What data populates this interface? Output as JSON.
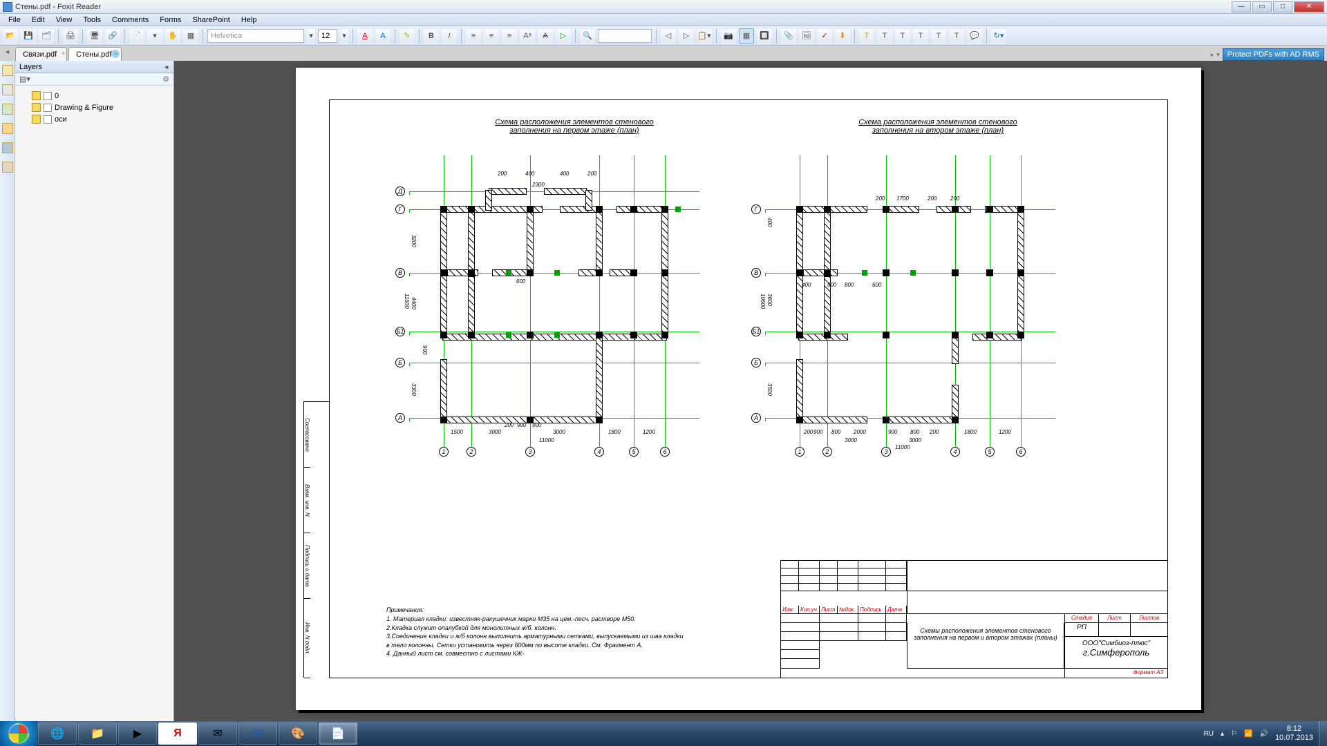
{
  "window": {
    "title": "Стены.pdf - Foxit Reader"
  },
  "menu": {
    "file": "File",
    "edit": "Edit",
    "view": "View",
    "tools": "Tools",
    "comments": "Comments",
    "forms": "Forms",
    "sharepoint": "SharePoint",
    "help": "Help"
  },
  "toolbar": {
    "font": "Helvetica",
    "size": "12"
  },
  "tabs": {
    "t1": "Связи.pdf",
    "t2": "Стены.pdf",
    "protect": "Protect PDFs with AD RMS"
  },
  "layers": {
    "title": "Layers",
    "layer0": "0",
    "layer_df": "Drawing & Figure",
    "layer_axes": "оси"
  },
  "drawing": {
    "title1a": "Схема расположения элементов стенового",
    "title1b": "заполнения на первом этаже (план)",
    "title2a": "Схема расположения элементов стенового",
    "title2b": "заполнения на втором этаже (план)",
    "axes_letters": {
      "A": "А",
      "B": "Б",
      "B1": "Б1",
      "V": "В",
      "G": "Г",
      "D": "Д"
    },
    "axes_nums": {
      "n1": "1",
      "n2": "2",
      "n3": "3",
      "n4": "4",
      "n5": "5",
      "n6": "6"
    },
    "dims": {
      "d200": "200",
      "d400": "400",
      "d600": "600",
      "d800": "800",
      "d900": "900",
      "d1200": "1200",
      "d1500": "1500",
      "d1700": "1700",
      "d1800": "1800",
      "d2000": "2000",
      "d2300": "2300",
      "d3000": "3000",
      "d3200": "3200",
      "d3300": "3300",
      "d3500": "3500",
      "d3600": "3600",
      "d4400": "4400",
      "d10600": "10600",
      "d11000": "11000",
      "d11500": "11500"
    },
    "notes_h": "Примечания:",
    "n1": "1. Материал кладки: известняк-ракушечник марки М35 на цем.-песч. растворе М50.",
    "n2": "2.Кладка служит опалубкой для монолитных ж/б. колонн.",
    "n3": "3.Соединение кладки и ж/б колонн выполнить арматурными сетками, выпускаемыми из шва кладки",
    "n3b": "в тело колонны. Сетки установить через 600мм по высоте кладки. См. Фрагмент А.",
    "n4": "4. Данный лист см. совместно с листами КЖ-",
    "tb": {
      "izm": "Изм.",
      "koluch": "Кол.уч",
      "list": "Лист",
      "ndok": "№док.",
      "podpis": "Подпись",
      "data": "Дата",
      "project": "Схемы расположения элементов стенового заполнения на первом и втором этажах (планы)",
      "stadiya": "Стадия",
      "list2": "Лист",
      "listov": "Листов",
      "rp": "РП",
      "org": "ООО\"Симбиоз-плюс\"",
      "city": "г.Симферополь",
      "format": "Формат А3"
    },
    "stamps": {
      "s1": "Инв. N подл.",
      "s2": "Подпись и дата",
      "s3": "Взам. инв. N",
      "s4": "Согласовано"
    }
  },
  "systray": {
    "lang": "RU",
    "time": "8:12",
    "date": "10.07.2013"
  }
}
